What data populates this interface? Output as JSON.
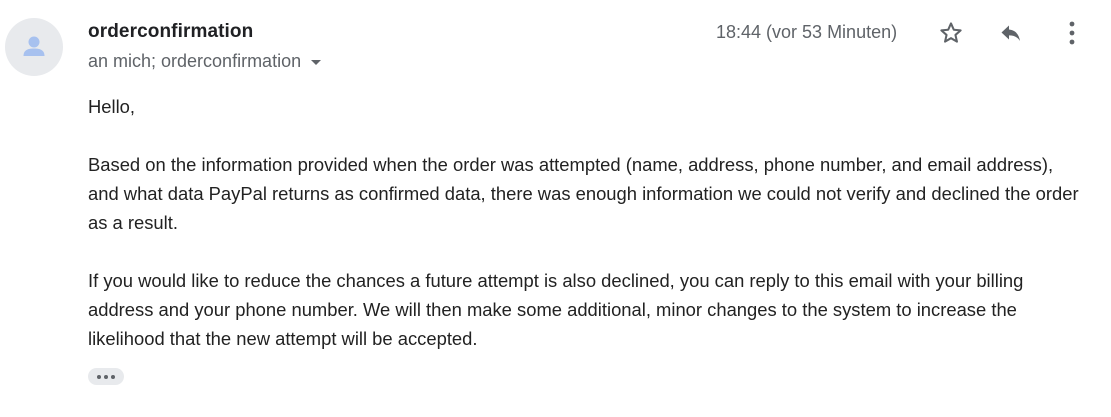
{
  "message": {
    "sender": "orderconfirmation",
    "recipients": "an mich; orderconfirmation",
    "timestamp": "18:44 (vor 53 Minuten)",
    "icons": {
      "avatar": "person-avatar-icon",
      "star": "star-outline-icon",
      "reply": "reply-icon",
      "more": "more-vert-icon",
      "expand": "chevron-down-icon",
      "trimmed": "ellipsis-icon"
    },
    "body": {
      "greeting": "Hello,",
      "paragraph1": "Based on the information provided when the order was attempted (name, address, phone number, and email address), and what data PayPal returns as confirmed data, there was enough information we could not verify and declined the order as a result.",
      "paragraph2": "If you would like to reduce the chances a future attempt is also declined, you can reply to this email with your billing address and your phone number.  We will then make some additional, minor changes to the system to increase the likelihood that the new attempt will be accepted."
    }
  },
  "colors": {
    "avatar_bg": "#e8eaed",
    "avatar_fg": "#a7c1ef",
    "muted_text": "#5f6368",
    "body_text": "#222222"
  }
}
